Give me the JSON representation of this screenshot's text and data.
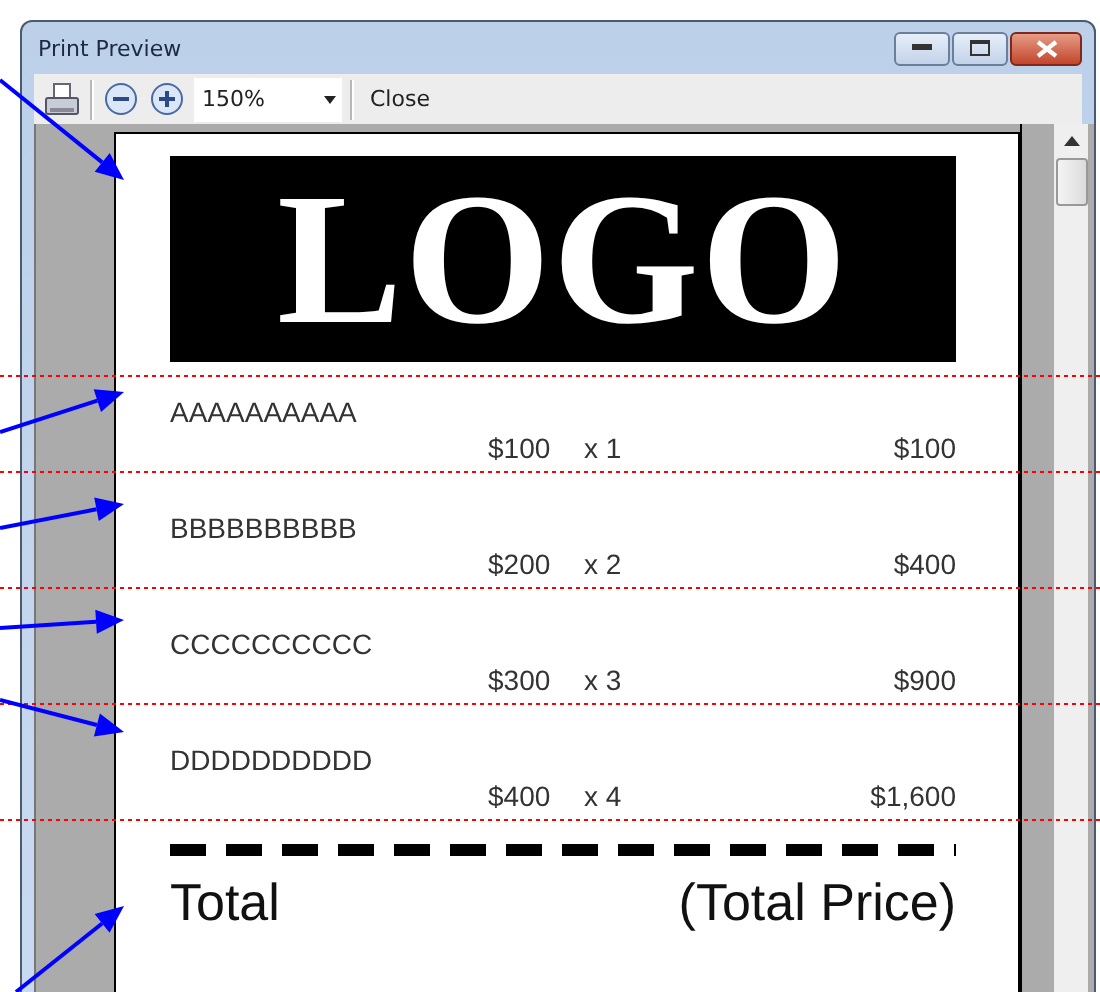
{
  "window": {
    "title": "Print Preview"
  },
  "toolbar": {
    "zoom": "150%",
    "close_label": "Close"
  },
  "page": {
    "logo": "LOGO",
    "items": [
      {
        "name": "AAAAAAAAAA",
        "price": "$100",
        "quantity": "x 1",
        "amount": "$100"
      },
      {
        "name": "BBBBBBBBBB",
        "price": "$200",
        "quantity": "x 2",
        "amount": "$400"
      },
      {
        "name": "CCCCCCCCCC",
        "price": "$300",
        "quantity": "x 3",
        "amount": "$900"
      },
      {
        "name": "DDDDDDDDDD",
        "price": "$400",
        "quantity": "x 4",
        "amount": "$1,600"
      }
    ],
    "total_label": "Total",
    "total_value": "(Total Price)"
  }
}
